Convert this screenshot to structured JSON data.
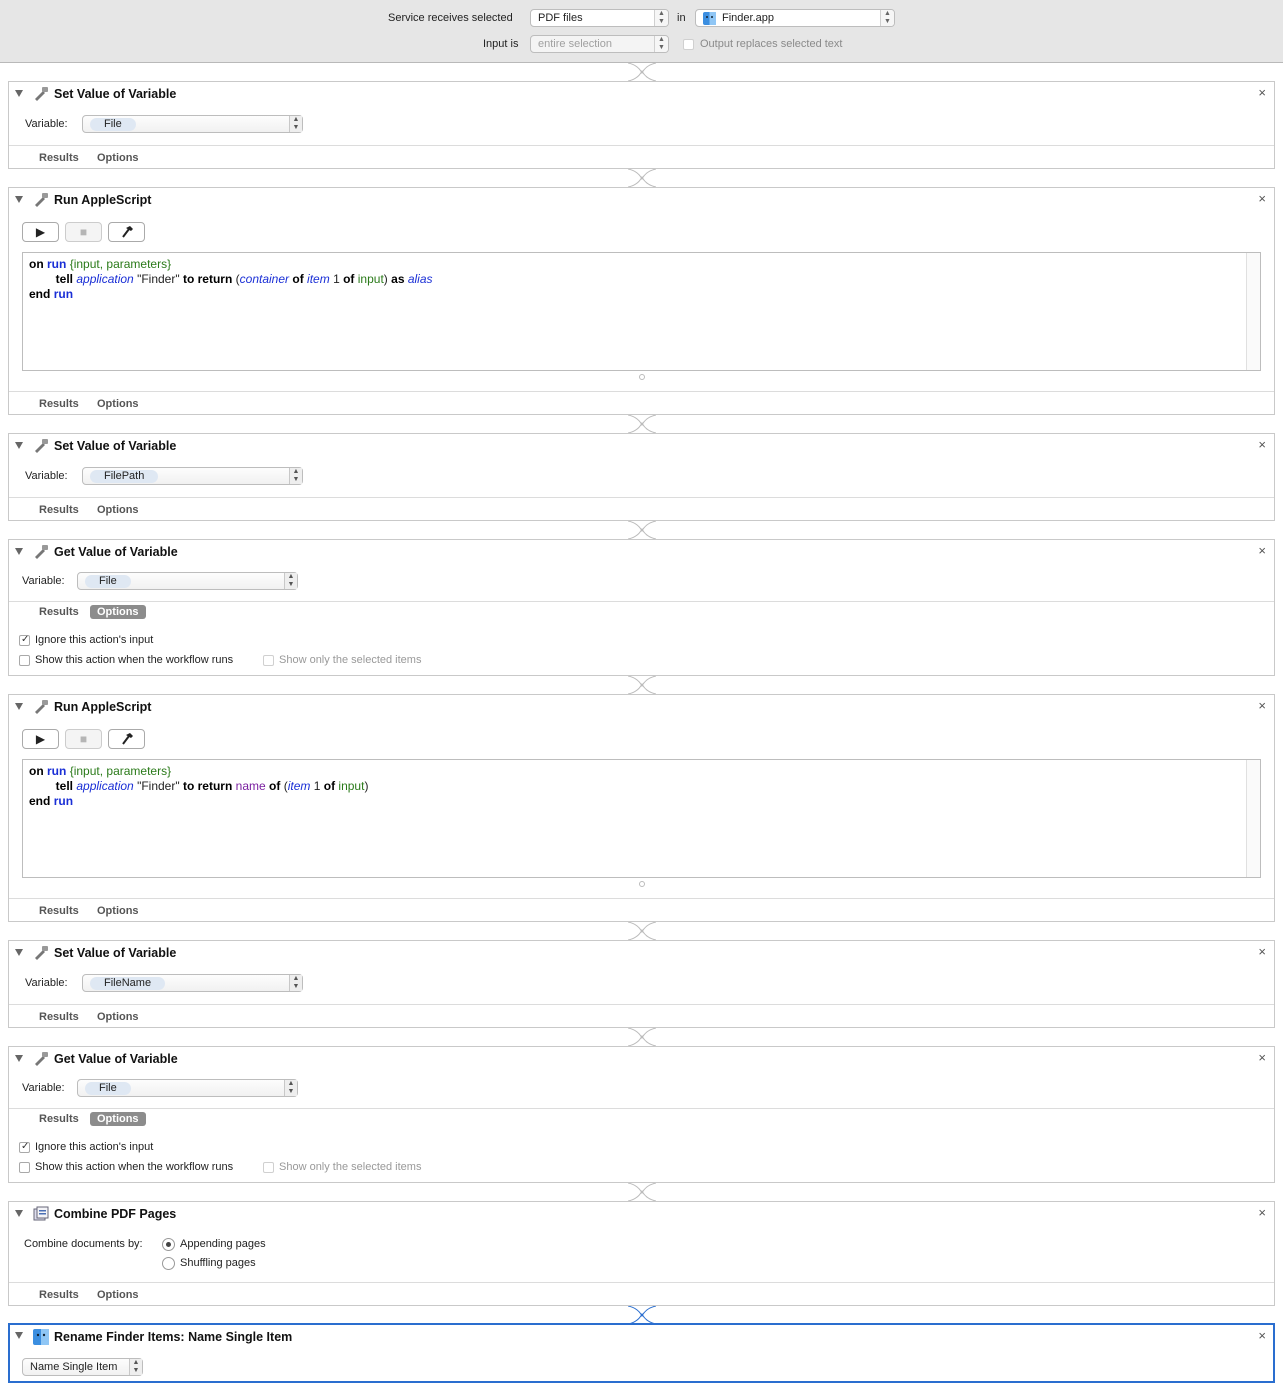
{
  "top": {
    "service_label": "Service receives selected",
    "service_value": "PDF files",
    "in_label": "in",
    "app_value": "Finder.app",
    "input_label": "Input is",
    "input_value": "entire selection",
    "output_replaces": "Output replaces selected text"
  },
  "common": {
    "variable_label": "Variable:",
    "results": "Results",
    "options": "Options",
    "ignore_input": "Ignore this action's input",
    "show_when_runs": "Show this action when the workflow runs",
    "show_selected": "Show only the selected items"
  },
  "actions": [
    {
      "title": "Set Value of Variable",
      "variable": "File"
    },
    {
      "title": "Run AppleScript"
    },
    {
      "title": "Set Value of Variable",
      "variable": "FilePath"
    },
    {
      "title": "Get Value of Variable",
      "variable": "File"
    },
    {
      "title": "Run AppleScript"
    },
    {
      "title": "Set Value of Variable",
      "variable": "FileName"
    },
    {
      "title": "Get Value of Variable",
      "variable": "File"
    },
    {
      "title": "Combine PDF Pages",
      "combine_label": "Combine documents by:",
      "opt1": "Appending pages",
      "opt2": "Shuffling pages"
    },
    {
      "title": "Rename Finder Items: Name Single Item",
      "popup": "Name Single Item"
    }
  ],
  "script1": {
    "l1": {
      "on": "on",
      "run": "run",
      "args": "{input, parameters}"
    },
    "l2": {
      "tell": "tell",
      "application": "application",
      "finder": "\"Finder\"",
      "to": "to",
      "return": "return",
      "container": "container",
      "of": "of",
      "item": "item",
      "one": "1",
      "input": "input",
      "as": "as",
      "alias": "alias"
    },
    "l3": {
      "end": "end",
      "run": "run"
    }
  },
  "script2": {
    "l1": {
      "on": "on",
      "run": "run",
      "args": "{input, parameters}"
    },
    "l2": {
      "tell": "tell",
      "application": "application",
      "finder": "\"Finder\"",
      "to": "to",
      "return": "return",
      "name": "name",
      "of": "of",
      "item": "item",
      "one": "1",
      "input": "input"
    },
    "l3": {
      "end": "end",
      "run": "run"
    }
  }
}
